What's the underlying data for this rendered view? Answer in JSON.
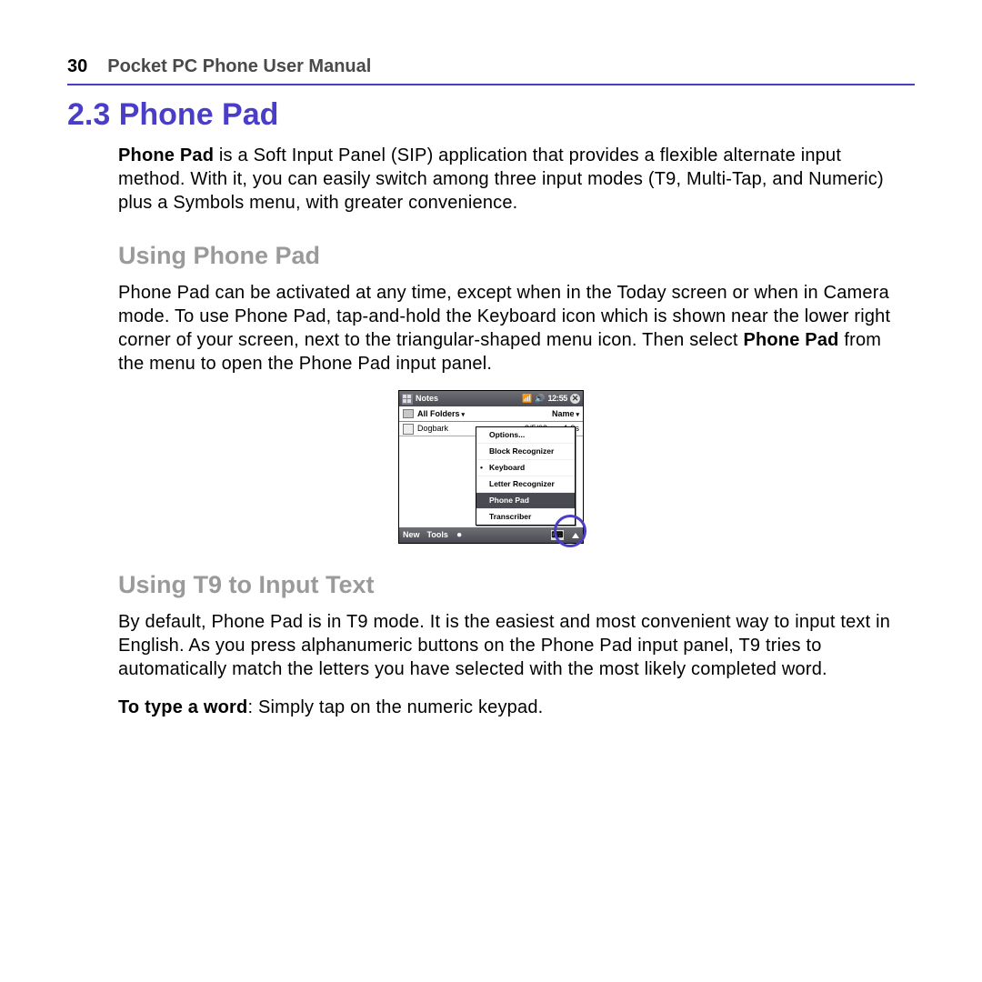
{
  "header": {
    "page_number": "30",
    "running_title": "Pocket PC Phone User Manual"
  },
  "section": {
    "number_title": "2.3 Phone Pad"
  },
  "para1": {
    "lead_bold": "Phone Pad",
    "rest": " is a Soft Input Panel (SIP) application that provides a flexible alternate input method. With it, you can easily switch among three input modes (T9, Multi-Tap, and Numeric) plus a Symbols menu, with greater convenience."
  },
  "heading_using": "Using Phone Pad",
  "para2": {
    "part_a": "Phone Pad can be activated at any time, except when in the Today screen or when in Camera mode. To use Phone Pad, tap-and-hold the Keyboard icon which is shown near the lower right corner of your screen, next to the triangular-shaped menu icon. Then select ",
    "bold": "Phone Pad",
    "part_b": " from the menu to open the Phone Pad input panel."
  },
  "screenshot": {
    "titlebar": {
      "app": "Notes",
      "time": "12:55"
    },
    "folder_row": {
      "folders_label": "All Folders",
      "name_label": "Name"
    },
    "list_item": {
      "name": "Dogbark",
      "date": "8/5/03",
      "size": "1.9s"
    },
    "menu": {
      "items": [
        {
          "label": "Options...",
          "selected": false,
          "dot": false
        },
        {
          "label": "Block Recognizer",
          "selected": false,
          "dot": false
        },
        {
          "label": "Keyboard",
          "selected": false,
          "dot": true
        },
        {
          "label": "Letter Recognizer",
          "selected": false,
          "dot": false
        },
        {
          "label": "Phone Pad",
          "selected": true,
          "dot": false
        },
        {
          "label": "Transcriber",
          "selected": false,
          "dot": false
        }
      ]
    },
    "bottombar": {
      "new": "New",
      "tools": "Tools"
    }
  },
  "heading_t9": "Using T9 to Input Text",
  "para3": "By default, Phone Pad is in T9 mode. It is the easiest and most convenient way to input text in English. As you press alphanumeric buttons on the Phone Pad input panel, T9 tries to automatically match the letters you have selected with the most likely completed word.",
  "para4": {
    "lead_bold": "To type a word",
    "rest": ": Simply tap on the numeric keypad."
  }
}
